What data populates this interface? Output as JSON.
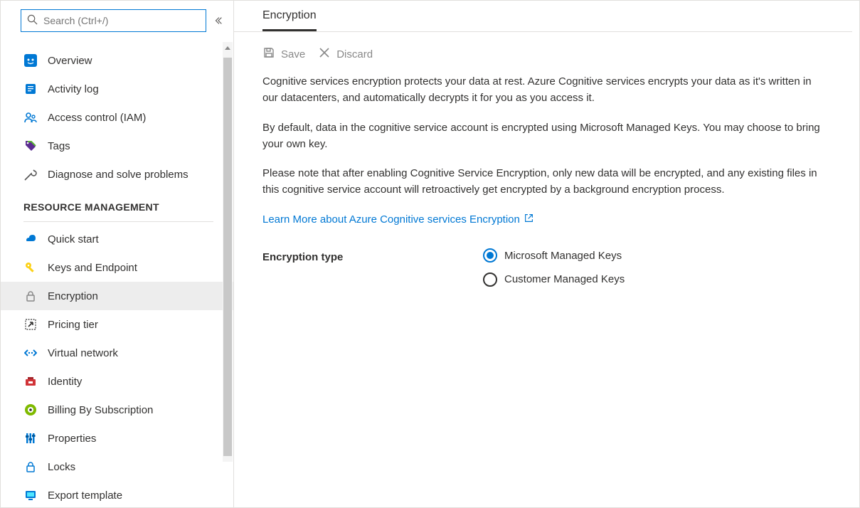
{
  "search": {
    "placeholder": "Search (Ctrl+/)"
  },
  "sidebar": {
    "general": [
      {
        "label": "Overview"
      },
      {
        "label": "Activity log"
      },
      {
        "label": "Access control (IAM)"
      },
      {
        "label": "Tags"
      },
      {
        "label": "Diagnose and solve problems"
      }
    ],
    "section_header": "RESOURCE MANAGEMENT",
    "management": [
      {
        "label": "Quick start"
      },
      {
        "label": "Keys and Endpoint"
      },
      {
        "label": "Encryption"
      },
      {
        "label": "Pricing tier"
      },
      {
        "label": "Virtual network"
      },
      {
        "label": "Identity"
      },
      {
        "label": "Billing By Subscription"
      },
      {
        "label": "Properties"
      },
      {
        "label": "Locks"
      },
      {
        "label": "Export template"
      }
    ]
  },
  "page": {
    "tab": "Encryption",
    "toolbar": {
      "save": "Save",
      "discard": "Discard"
    },
    "para1": "Cognitive services encryption protects your data at rest. Azure Cognitive services encrypts your data as it's written in our datacenters, and automatically decrypts it for you as you access it.",
    "para2": "By default, data in the cognitive service account is encrypted using Microsoft Managed Keys. You may choose to bring your own key.",
    "para3": "Please note that after enabling Cognitive Service Encryption, only new data will be encrypted, and any existing files in this cognitive service account will retroactively get encrypted by a background encryption process.",
    "link": "Learn More about Azure Cognitive services Encryption",
    "form": {
      "label": "Encryption type",
      "options": [
        {
          "label": "Microsoft Managed Keys",
          "selected": true
        },
        {
          "label": "Customer Managed Keys",
          "selected": false
        }
      ]
    }
  }
}
